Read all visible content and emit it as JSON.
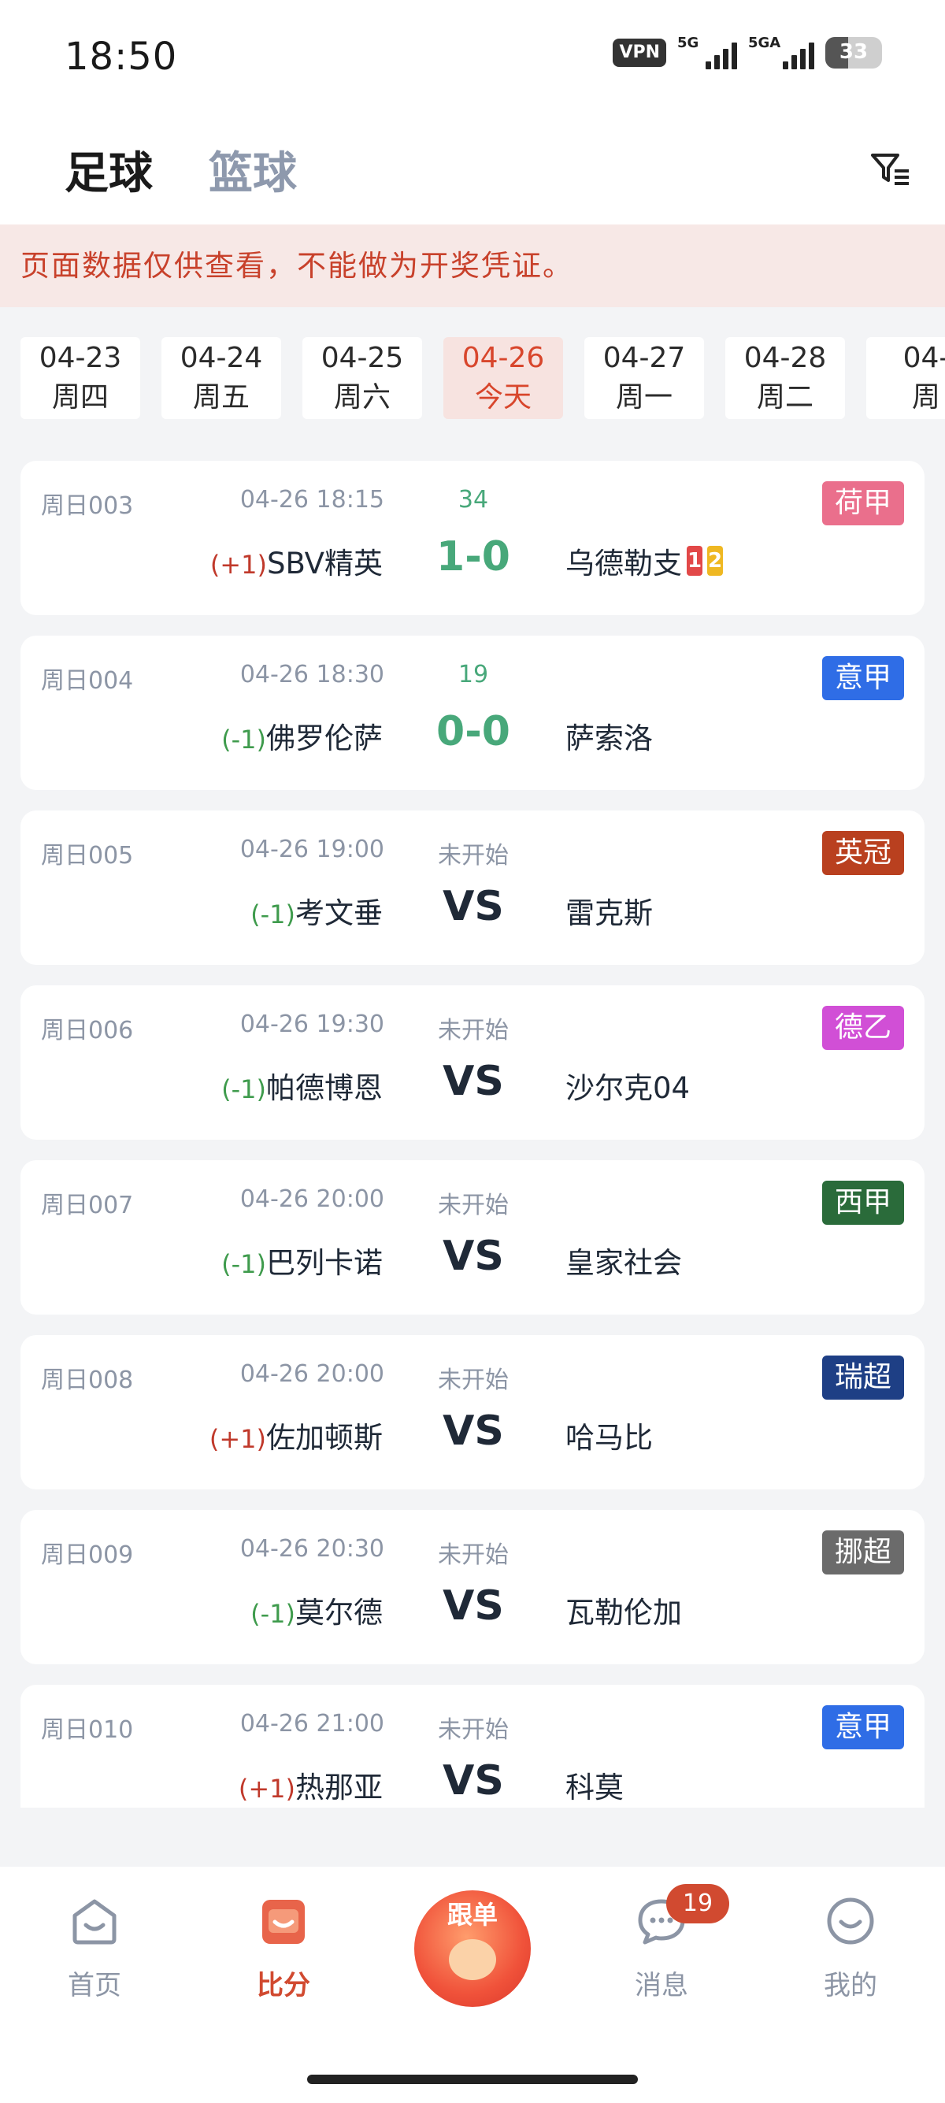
{
  "status_bar": {
    "time": "18:50",
    "vpn": "VPN",
    "sim1": "5G",
    "sim2": "5GA",
    "battery": "33"
  },
  "header": {
    "tab_active": "足球",
    "tab_inactive": "篮球",
    "filter_icon": "filter-icon"
  },
  "notice": "页面数据仅供查看，不能做为开奖凭证。",
  "dates": [
    {
      "date": "04-23",
      "day": "周四"
    },
    {
      "date": "04-24",
      "day": "周五"
    },
    {
      "date": "04-25",
      "day": "周六"
    },
    {
      "date": "04-26",
      "day": "今天",
      "active": true
    },
    {
      "date": "04-27",
      "day": "周一"
    },
    {
      "date": "04-28",
      "day": "周二"
    },
    {
      "date": "04-",
      "day": "周"
    }
  ],
  "matches": [
    {
      "code": "周日003",
      "kickoff": "04-26 18:15",
      "status": "34",
      "league": "荷甲",
      "league_color": "#ea6f8c",
      "handicap": "(+1)",
      "home": "SBV精英",
      "mid": "1-0",
      "away": "乌德勒支",
      "red_cards": "1",
      "yellow_cards": "2"
    },
    {
      "code": "周日004",
      "kickoff": "04-26 18:30",
      "status": "19",
      "league": "意甲",
      "league_color": "#2f6de6",
      "handicap": "(-1)",
      "home": "佛罗伦萨",
      "mid": "0-0",
      "away": "萨索洛"
    },
    {
      "code": "周日005",
      "kickoff": "04-26 19:00",
      "status": "未开始",
      "league": "英冠",
      "league_color": "#b9401f",
      "handicap": "(-1)",
      "home": "考文垂",
      "mid": "VS",
      "away": "雷克斯"
    },
    {
      "code": "周日006",
      "kickoff": "04-26 19:30",
      "status": "未开始",
      "league": "德乙",
      "league_color": "#d14fd6",
      "handicap": "(-1)",
      "home": "帕德博恩",
      "mid": "VS",
      "away": "沙尔克04"
    },
    {
      "code": "周日007",
      "kickoff": "04-26 20:00",
      "status": "未开始",
      "league": "西甲",
      "league_color": "#2a6b3a",
      "handicap": "(-1)",
      "home": "巴列卡诺",
      "mid": "VS",
      "away": "皇家社会"
    },
    {
      "code": "周日008",
      "kickoff": "04-26 20:00",
      "status": "未开始",
      "league": "瑞超",
      "league_color": "#1e3f85",
      "handicap": "(+1)",
      "home": "佐加顿斯",
      "mid": "VS",
      "away": "哈马比"
    },
    {
      "code": "周日009",
      "kickoff": "04-26 20:30",
      "status": "未开始",
      "league": "挪超",
      "league_color": "#6b6b6b",
      "handicap": "(-1)",
      "home": "莫尔德",
      "mid": "VS",
      "away": "瓦勒伦加"
    },
    {
      "code": "周日010",
      "kickoff": "04-26 21:00",
      "status": "未开始",
      "league": "意甲",
      "league_color": "#2f6de6",
      "handicap": "(+1)",
      "home": "热那亚",
      "mid": "VS",
      "away": "科莫"
    }
  ],
  "nav": {
    "home": "首页",
    "score": "比分",
    "follow": "跟单",
    "messages": "消息",
    "messages_badge": "19",
    "mine": "我的"
  }
}
